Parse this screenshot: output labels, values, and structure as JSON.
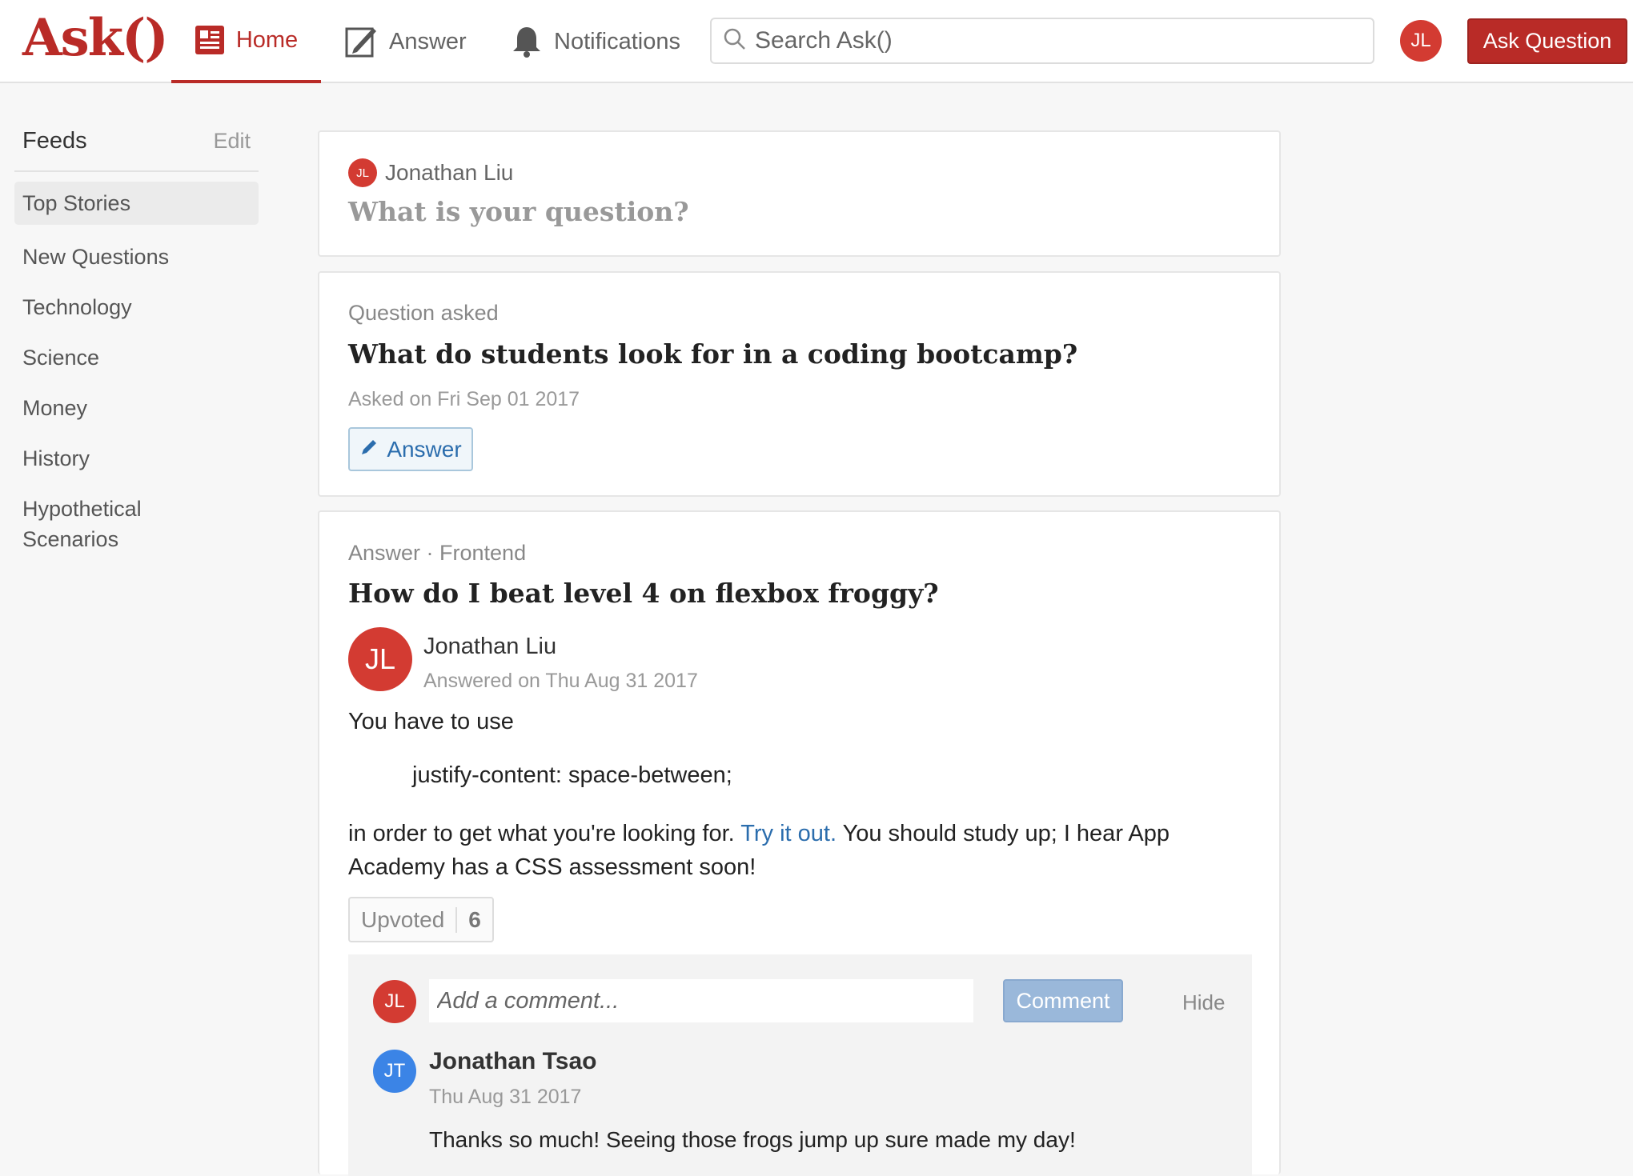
{
  "header": {
    "logo": "Ask()",
    "nav": {
      "home": "Home",
      "answer": "Answer",
      "notifications": "Notifications"
    },
    "search_placeholder": "Search Ask()",
    "user_initials": "JL",
    "ask_button": "Ask Question"
  },
  "sidebar": {
    "title": "Feeds",
    "edit": "Edit",
    "items": [
      "Top Stories",
      "New Questions",
      "Technology",
      "Science",
      "Money",
      "History",
      "Hypothetical Scenarios"
    ]
  },
  "ask_box": {
    "initials": "JL",
    "user_name": "Jonathan Liu",
    "prompt": "What is your question?"
  },
  "question_card": {
    "label": "Question asked",
    "title": "What do students look for in a coding bootcamp?",
    "asked_on": "Asked on Fri Sep 01 2017",
    "answer_button": "Answer"
  },
  "answer_card": {
    "label": "Answer · Frontend",
    "title": "How do I beat level 4 on flexbox froggy?",
    "author_initials": "JL",
    "author_name": "Jonathan Liu",
    "answered_on": "Answered on Thu Aug 31 2017",
    "line1": "You have to use",
    "code": "justify-content: space-between;",
    "line2_pre": "in order to get what you're looking for. ",
    "link": "Try it out.",
    "line2_post": " You should study up; I hear App Academy has a CSS assessment soon!",
    "upvote_label": "Upvoted",
    "upvote_count": "6"
  },
  "comments": {
    "initials": "JL",
    "placeholder": "Add a comment...",
    "comment_button": "Comment",
    "hide": "Hide",
    "items": [
      {
        "initials": "JT",
        "name": "Jonathan Tsao",
        "date": "Thu Aug 31 2017",
        "text": "Thanks so much! Seeing those frogs jump up sure made my day!"
      }
    ]
  },
  "colors": {
    "brand": "#b92b27",
    "avatar_red": "#d33b32",
    "avatar_blue": "#3b84e6",
    "link": "#2b6dad"
  }
}
